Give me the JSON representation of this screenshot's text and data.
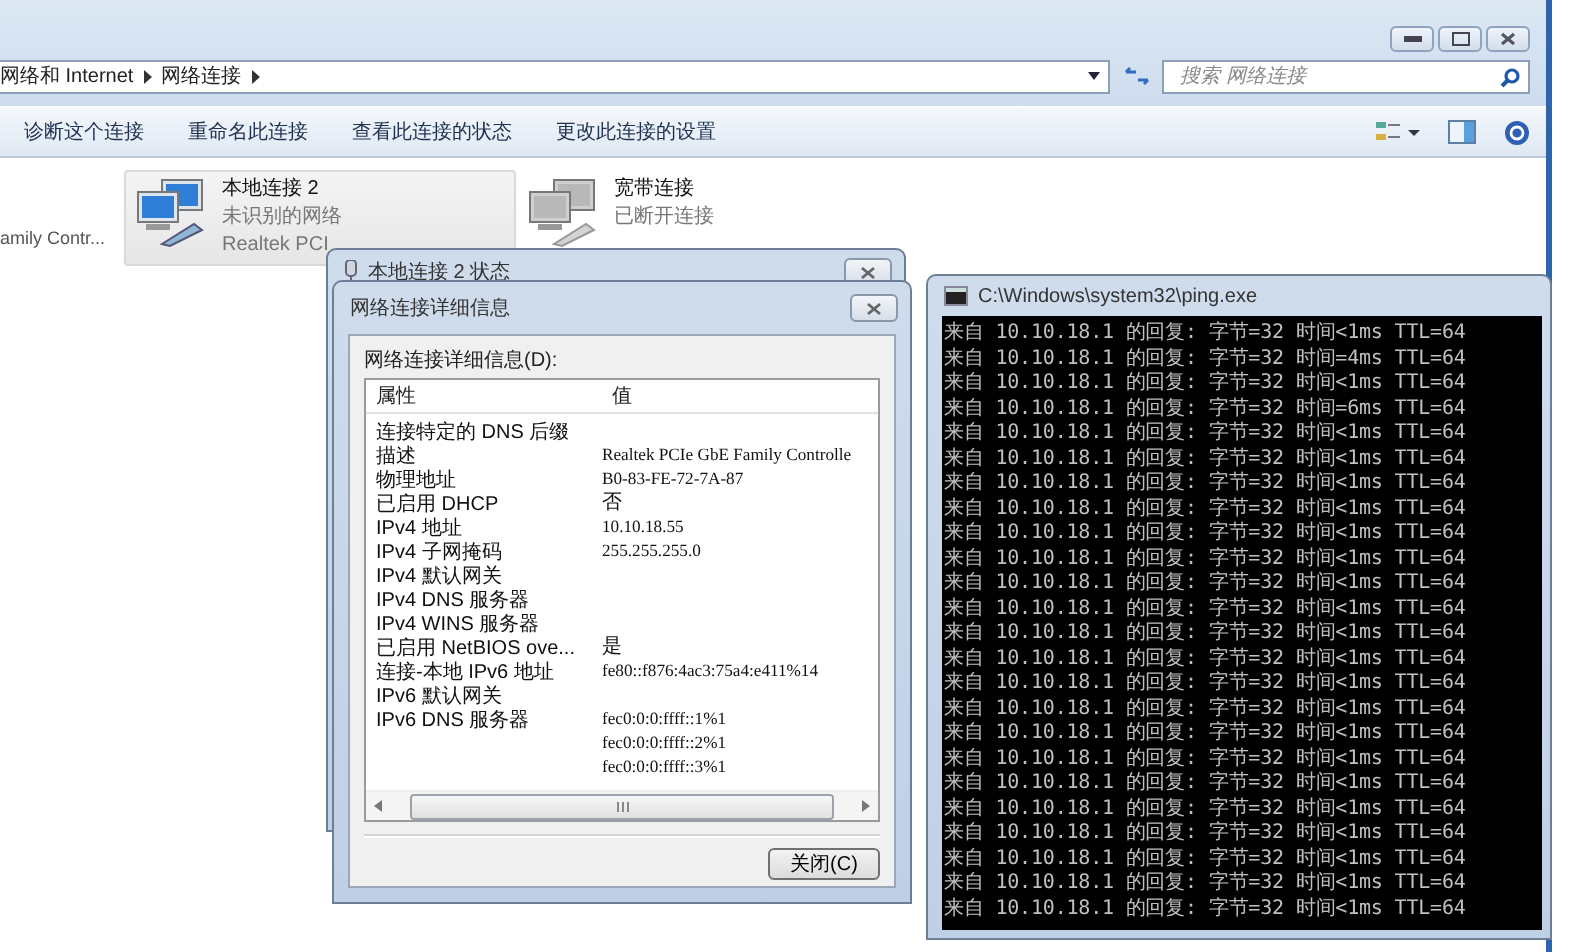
{
  "explorer": {
    "breadcrumbs": [
      "网络和 Internet",
      "网络连接"
    ],
    "search": {
      "placeholder": "搜索 网络连接"
    },
    "toolbar": [
      "诊断这个连接",
      "重命名此连接",
      "查看此连接的状态",
      "更改此连接的设置"
    ],
    "items": [
      {
        "kind": "partial",
        "adapter": "amily Contr..."
      },
      {
        "kind": "connection",
        "name": "本地连接 2",
        "status": "未识别的网络",
        "adapter": "Realtek PCI",
        "selected": true,
        "connected": true
      },
      {
        "kind": "connection",
        "name": "宽带连接",
        "status": "已断开连接",
        "selected": false,
        "connected": false
      }
    ]
  },
  "status_dialog": {
    "title": "本地连接 2 状态"
  },
  "details_dialog": {
    "title": "网络连接详细信息",
    "list_label": "网络连接详细信息(D):",
    "columns": [
      "属性",
      "值"
    ],
    "rows": [
      {
        "property": "连接特定的 DNS 后缀"
      },
      {
        "property": "描述",
        "value": "Realtek PCIe GbE Family Controlle"
      },
      {
        "property": "物理地址",
        "value": "B0-83-FE-72-7A-87"
      },
      {
        "property": "已启用 DHCP",
        "value": "否"
      },
      {
        "property": "IPv4 地址",
        "value": "10.10.18.55"
      },
      {
        "property": "IPv4 子网掩码",
        "value": "255.255.255.0"
      },
      {
        "property": "IPv4 默认网关"
      },
      {
        "property": "IPv4 DNS 服务器"
      },
      {
        "property": "IPv4 WINS 服务器"
      },
      {
        "property": "已启用 NetBIOS ove...",
        "value": "是"
      },
      {
        "property": "连接-本地 IPv6 地址",
        "value": "fe80::f876:4ac3:75a4:e411%14"
      },
      {
        "property": "IPv6 默认网关"
      },
      {
        "property": "IPv6 DNS 服务器",
        "value": "fec0:0:0:ffff::1%1"
      },
      {
        "value": "fec0:0:0:ffff::2%1"
      },
      {
        "value": "fec0:0:0:ffff::3%1"
      }
    ],
    "close_button": "关闭(C)"
  },
  "console": {
    "title": "C:\\Windows\\system32\\ping.exe",
    "lines": [
      "来自 10.10.18.1 的回复: 字节=32 时间<1ms TTL=64",
      "来自 10.10.18.1 的回复: 字节=32 时间=4ms TTL=64",
      "来自 10.10.18.1 的回复: 字节=32 时间<1ms TTL=64",
      "来自 10.10.18.1 的回复: 字节=32 时间=6ms TTL=64",
      "来自 10.10.18.1 的回复: 字节=32 时间<1ms TTL=64",
      "来自 10.10.18.1 的回复: 字节=32 时间<1ms TTL=64",
      "来自 10.10.18.1 的回复: 字节=32 时间<1ms TTL=64",
      "来自 10.10.18.1 的回复: 字节=32 时间<1ms TTL=64",
      "来自 10.10.18.1 的回复: 字节=32 时间<1ms TTL=64",
      "来自 10.10.18.1 的回复: 字节=32 时间<1ms TTL=64",
      "来自 10.10.18.1 的回复: 字节=32 时间<1ms TTL=64",
      "来自 10.10.18.1 的回复: 字节=32 时间<1ms TTL=64",
      "来自 10.10.18.1 的回复: 字节=32 时间<1ms TTL=64",
      "来自 10.10.18.1 的回复: 字节=32 时间<1ms TTL=64",
      "来自 10.10.18.1 的回复: 字节=32 时间<1ms TTL=64",
      "来自 10.10.18.1 的回复: 字节=32 时间<1ms TTL=64",
      "来自 10.10.18.1 的回复: 字节=32 时间<1ms TTL=64",
      "来自 10.10.18.1 的回复: 字节=32 时间<1ms TTL=64",
      "来自 10.10.18.1 的回复: 字节=32 时间<1ms TTL=64",
      "来自 10.10.18.1 的回复: 字节=32 时间<1ms TTL=64",
      "来自 10.10.18.1 的回复: 字节=32 时间<1ms TTL=64",
      "来自 10.10.18.1 的回复: 字节=32 时间<1ms TTL=64",
      "来自 10.10.18.1 的回复: 字节=32 时间<1ms TTL=64",
      "来自 10.10.18.1 的回复: 字节=32 时间<1ms TTL=64"
    ]
  }
}
